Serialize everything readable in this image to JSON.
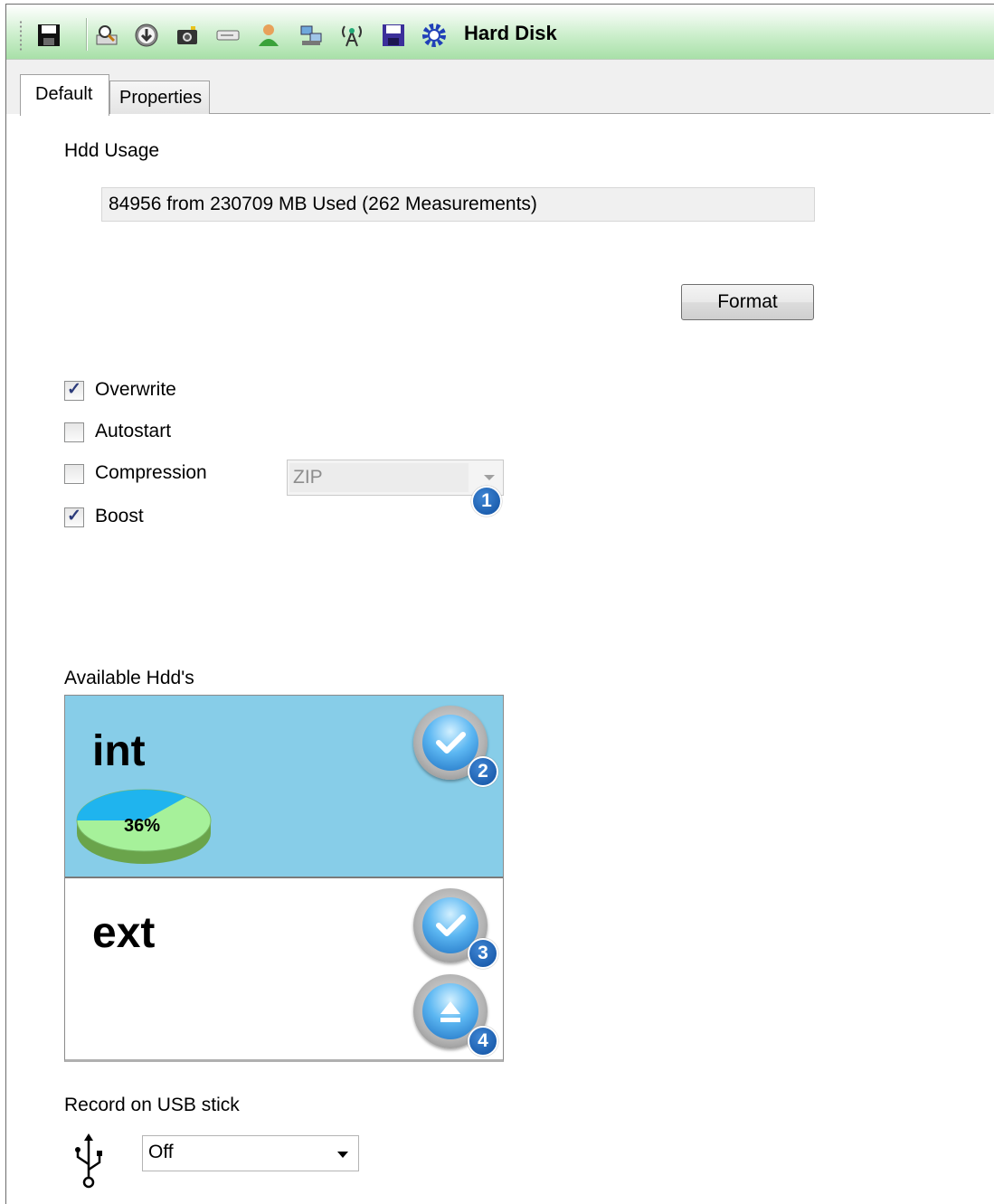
{
  "toolbar": {
    "icons": [
      "save-icon",
      "print-preview-icon",
      "download-icon",
      "camera-icon",
      "drive-icon",
      "user-icon",
      "network-icon",
      "antenna-icon",
      "disk-icon",
      "settings-icon"
    ],
    "title": "Hard Disk"
  },
  "tabs": [
    {
      "label": "Default",
      "selected": true
    },
    {
      "label": "Properties",
      "selected": false
    }
  ],
  "hdd_usage": {
    "heading": "Hdd Usage",
    "value": "84956 from 230709 MB Used (262 Measurements)",
    "format_label": "Format"
  },
  "options": {
    "overwrite": {
      "label": "Overwrite",
      "checked": true
    },
    "autostart": {
      "label": "Autostart",
      "checked": false
    },
    "compression": {
      "label": "Compression",
      "checked": false
    },
    "boost": {
      "label": "Boost",
      "checked": true
    },
    "compression_type": "ZIP"
  },
  "available": {
    "heading": "Available Hdd's",
    "drives": [
      {
        "name": "int",
        "usage_label": "36%",
        "usage_fraction": 0.36,
        "selected": true
      },
      {
        "name": "ext",
        "selected": false
      }
    ]
  },
  "badges": [
    "1",
    "2",
    "3",
    "4"
  ],
  "usb": {
    "heading": "Record on USB stick",
    "value": "Off"
  },
  "colors": {
    "toolbar_green": "#a8e0a8",
    "selected_drive": "#87cde8",
    "pie_used": "#1fb4ee",
    "pie_free": "#a6f19a",
    "badge_blue": "#1457a8"
  }
}
